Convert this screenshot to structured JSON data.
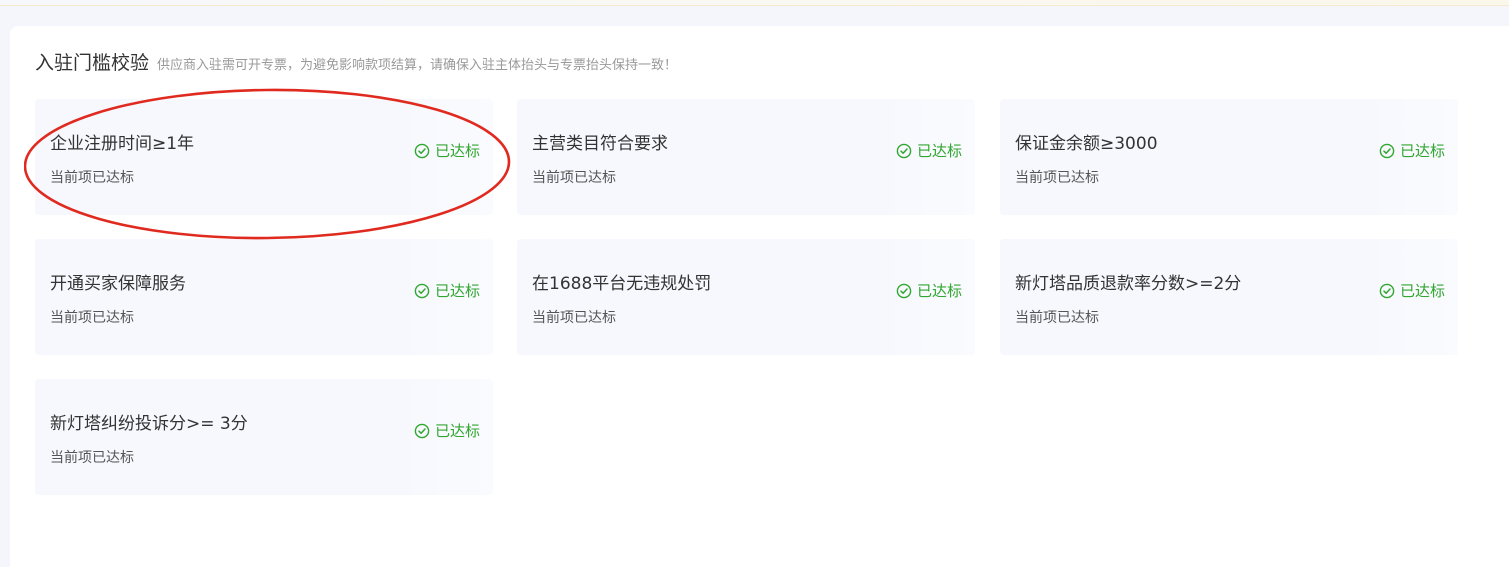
{
  "section": {
    "title": "入驻门槛校验",
    "note": "供应商入驻需可开专票，为避免影响款项结算，请确保入驻主体抬头与专票抬头保持一致！"
  },
  "cards": [
    {
      "title": "企业注册时间≥1年",
      "subtitle": "当前项已达标",
      "status": "已达标"
    },
    {
      "title": "主营类目符合要求",
      "subtitle": "当前项已达标",
      "status": "已达标"
    },
    {
      "title": "保证金余额≥3000",
      "subtitle": "当前项已达标",
      "status": "已达标"
    },
    {
      "title": "开通买家保障服务",
      "subtitle": "当前项已达标",
      "status": "已达标"
    },
    {
      "title": "在1688平台无违规处罚",
      "subtitle": "当前项已达标",
      "status": "已达标"
    },
    {
      "title": "新灯塔品质退款率分数>=2分",
      "subtitle": "当前项已达标",
      "status": "已达标"
    },
    {
      "title": "新灯塔纠纷投诉分>= 3分",
      "subtitle": "当前项已达标",
      "status": "已达标"
    }
  ],
  "colors": {
    "status_green": "#31a631",
    "card_bg": "#f6f8fd",
    "annotation_red": "#e02a1f"
  },
  "icons": {
    "status": "check-circle-icon"
  }
}
